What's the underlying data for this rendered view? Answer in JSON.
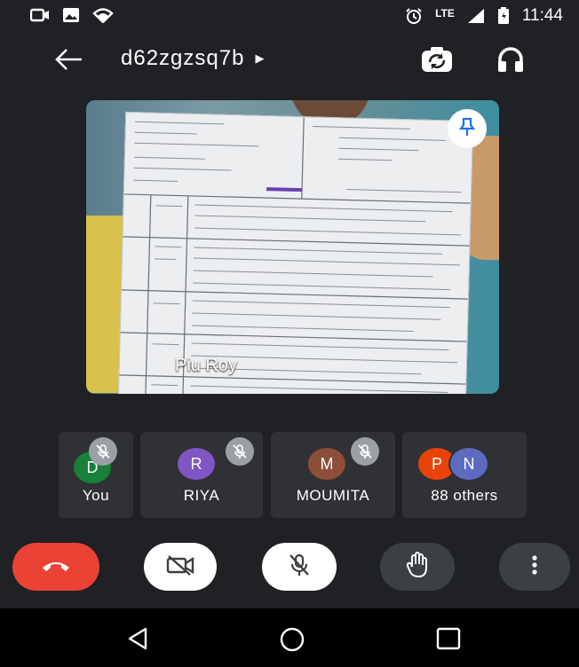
{
  "status_bar": {
    "time": "11:44",
    "network": "LTE"
  },
  "meeting": {
    "code": "d62zgzsq7b"
  },
  "main_tile": {
    "participant_name": "Piu Roy"
  },
  "participants": [
    {
      "label": "You",
      "initial": "D",
      "color": "#188038"
    },
    {
      "label": "RIYA",
      "initial": "R",
      "color": "#7e57c2"
    },
    {
      "label": "MOUMITA",
      "initial": "M",
      "color": "#8d4e3a"
    },
    {
      "label": "88 others",
      "initials": [
        "P",
        "N"
      ],
      "colors": [
        "#e8430b",
        "#5c6bc0"
      ]
    }
  ],
  "colors": {
    "background": "#202124",
    "tile": "#303134",
    "end_call": "#ea4335",
    "control_dark": "#3c4043"
  },
  "icons": [
    "camera-icon",
    "image-icon",
    "wifi-icon",
    "alarm-icon",
    "lte-icon",
    "signal-icon",
    "battery-icon",
    "back-arrow-icon",
    "switch-camera-icon",
    "headphones-icon",
    "pin-icon",
    "mic-off-icon",
    "end-call-icon",
    "video-off-icon",
    "raise-hand-icon",
    "more-vert-icon"
  ]
}
